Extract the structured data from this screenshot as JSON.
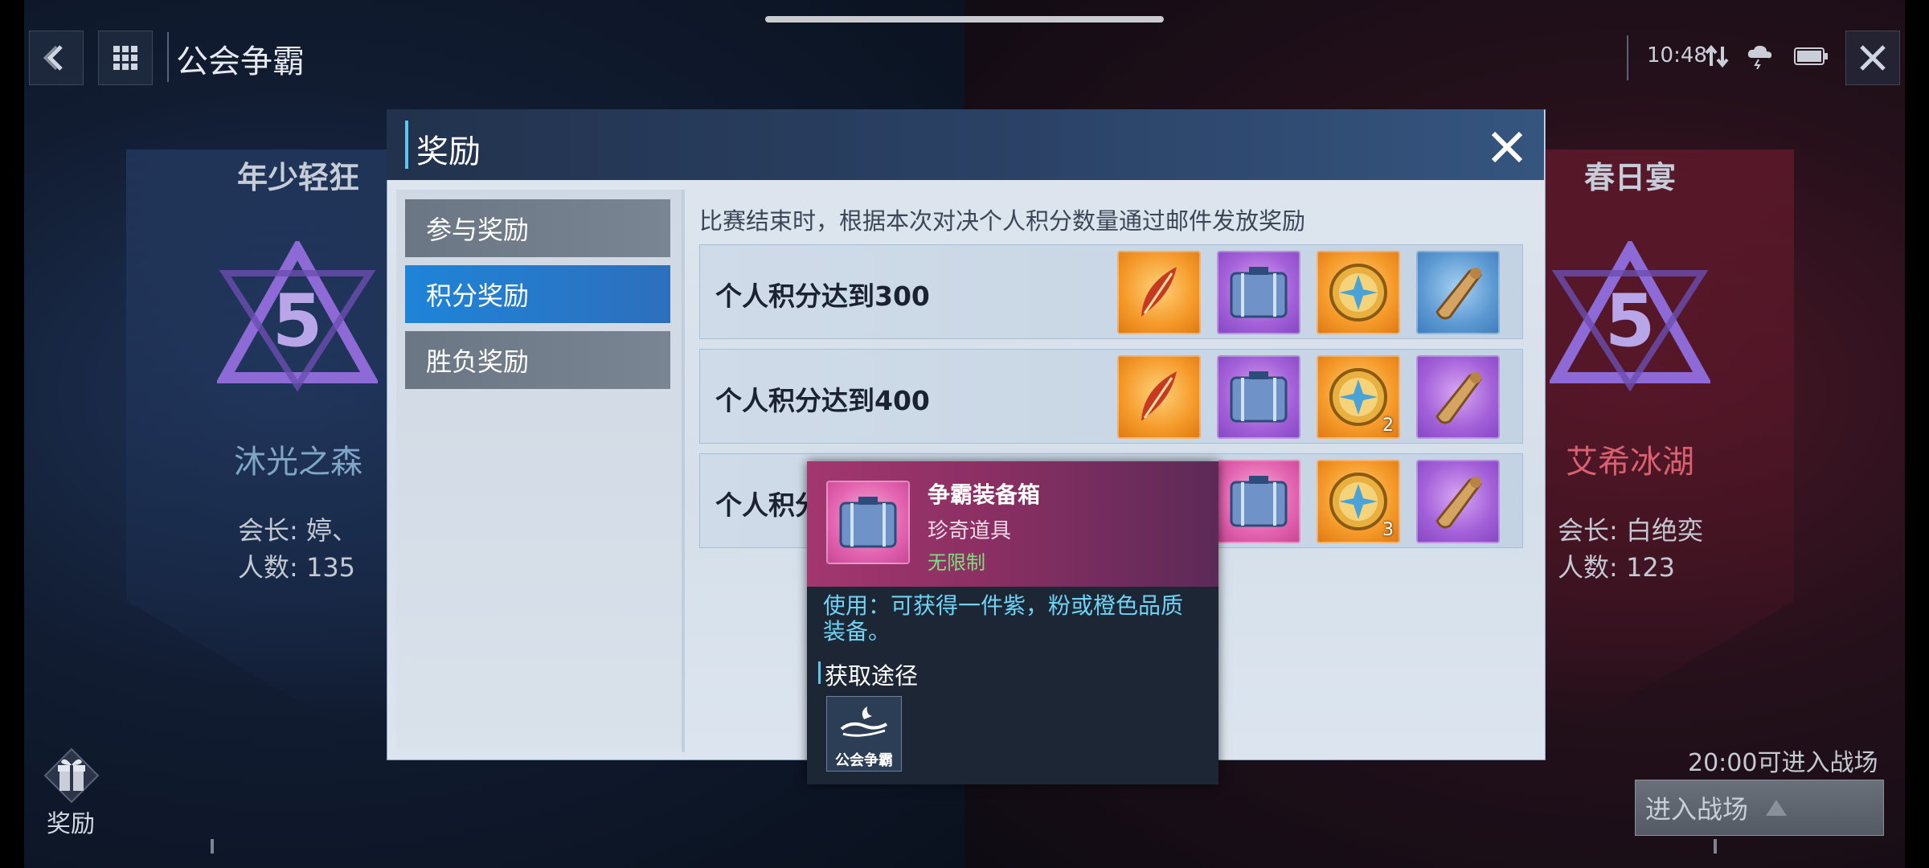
{
  "header": {
    "title": "公会争霸",
    "time": "10:48"
  },
  "teams": {
    "left": {
      "tag": "年少轻狂",
      "rank": "5",
      "guild": "沐光之森",
      "leader": "会长: 婷、",
      "members": "人数: 135"
    },
    "right": {
      "tag": "春日宴",
      "rank": "5",
      "guild": "艾希冰湖",
      "leader": "会长: 白绝奕",
      "members": "人数: 123"
    }
  },
  "modal": {
    "title": "奖励",
    "tabs": [
      {
        "label": "参与奖励",
        "active": false
      },
      {
        "label": "积分奖励",
        "active": true
      },
      {
        "label": "胜负奖励",
        "active": false
      }
    ],
    "description": "比赛结束时，根据本次对决个人积分数量通过邮件发放奖励",
    "rows": [
      {
        "label": "个人积分达到300",
        "items": [
          {
            "icon": "feather-icon",
            "quality": "orange",
            "count": ""
          },
          {
            "icon": "chest-icon",
            "quality": "purple",
            "count": ""
          },
          {
            "icon": "medal-icon",
            "quality": "orange",
            "count": ""
          },
          {
            "icon": "scroll-icon",
            "quality": "blue",
            "count": ""
          }
        ]
      },
      {
        "label": "个人积分达到400",
        "items": [
          {
            "icon": "feather-icon",
            "quality": "orange",
            "count": ""
          },
          {
            "icon": "chest-icon",
            "quality": "purple",
            "count": ""
          },
          {
            "icon": "medal-icon",
            "quality": "orange",
            "count": "2"
          },
          {
            "icon": "scroll-icon",
            "quality": "purple",
            "count": ""
          }
        ]
      },
      {
        "label": "个人积分",
        "items": [
          {
            "icon": "feather-icon",
            "quality": "orange",
            "count": ""
          },
          {
            "icon": "chest-icon",
            "quality": "pink",
            "count": ""
          },
          {
            "icon": "medal-icon",
            "quality": "orange",
            "count": "3"
          },
          {
            "icon": "scroll-icon",
            "quality": "purple",
            "count": ""
          }
        ]
      }
    ]
  },
  "tooltip": {
    "name": "争霸装备箱",
    "type": "珍奇道具",
    "limit": "无限制",
    "use": "使用：可获得一件紫，粉或橙色品质装备。",
    "source_title": "获取途径",
    "source_label": "公会争霸"
  },
  "bottom": {
    "reward_label": "奖励",
    "enter_time": "20:00可进入战场",
    "enter_button": "进入战场"
  },
  "colors": {
    "accent": "#5fc6f4",
    "tab_active": "#1f84d8",
    "limit_green": "#7fe07b"
  }
}
